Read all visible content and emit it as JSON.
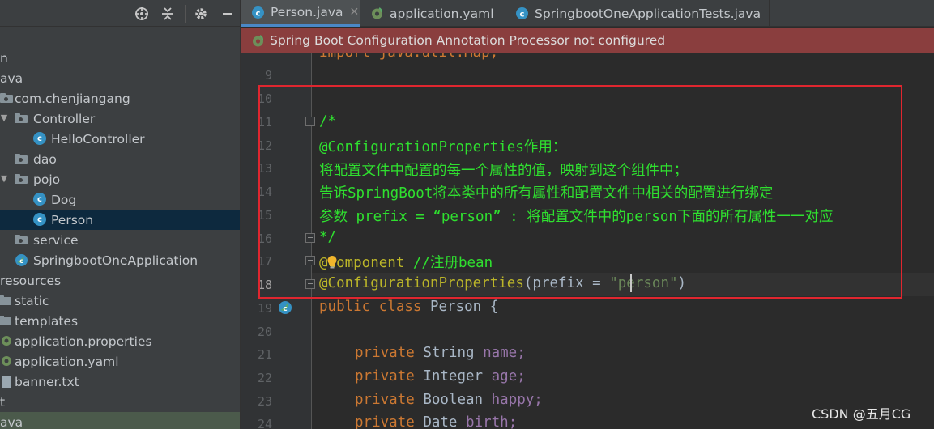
{
  "sidebar": {
    "toolbar_icons": [
      "target-icon",
      "collapse-icon",
      "gear-icon",
      "minimize-icon"
    ],
    "tree": [
      {
        "label": "n",
        "type": "text"
      },
      {
        "label": "ava",
        "type": "text"
      },
      {
        "label": "com.chenjiangang",
        "type": "package"
      },
      {
        "label": "Controller",
        "type": "package"
      },
      {
        "label": "HelloController",
        "type": "class"
      },
      {
        "label": "dao",
        "type": "package"
      },
      {
        "label": "pojo",
        "type": "package"
      },
      {
        "label": "Dog",
        "type": "class"
      },
      {
        "label": "Person",
        "type": "class",
        "selected": true
      },
      {
        "label": "service",
        "type": "package"
      },
      {
        "label": "SpringbootOneApplication",
        "type": "spring-class"
      },
      {
        "label": "resources",
        "type": "text"
      },
      {
        "label": "static",
        "type": "folder"
      },
      {
        "label": "templates",
        "type": "folder"
      },
      {
        "label": "application.properties",
        "type": "spring-file"
      },
      {
        "label": "application.yaml",
        "type": "spring-file"
      },
      {
        "label": "banner.txt",
        "type": "file"
      },
      {
        "label": "t",
        "type": "text"
      },
      {
        "label": "ava",
        "type": "text"
      }
    ]
  },
  "tabs": [
    {
      "label": "Person.java",
      "icon": "class-icon",
      "active": true,
      "closable": true
    },
    {
      "label": "application.yaml",
      "icon": "spring-config-icon",
      "active": false,
      "closable": false
    },
    {
      "label": "SpringbootOneApplicationTests.java",
      "icon": "class-icon",
      "active": false,
      "closable": false
    }
  ],
  "banner": {
    "text": "Spring Boot Configuration Annotation Processor not configured",
    "color": "#8a3e3e"
  },
  "editor": {
    "partial_top_line": "import java.util.Map;",
    "line_numbers": [
      "9",
      "10",
      "11",
      "12",
      "13",
      "14",
      "15",
      "16",
      "17",
      "18",
      "19",
      "20",
      "21",
      "22",
      "23",
      "24"
    ],
    "current_line": "18",
    "comment": {
      "open": "/*",
      "line1": "@ConfigurationProperties作用：",
      "line2": "将配置文件中配置的每一个属性的值，映射到这个组件中；",
      "line3": "告诉SpringBoot将本类中的所有属性和配置文件中相关的配置进行绑定",
      "line4": "参数 prefix = “person” : 将配置文件中的person下面的所有属性一一对应",
      "close": "*/"
    },
    "component_anno": "@Component",
    "component_comment": "//注册bean",
    "config_anno": "@ConfigurationProperties",
    "config_open": "(prefix = ",
    "config_str": "\"person\"",
    "config_close": ")",
    "class_kw": "public class",
    "class_name": "Person {",
    "fields": [
      {
        "kw": "private",
        "type": "String",
        "name": "name;"
      },
      {
        "kw": "private",
        "type": "Integer",
        "name": "age;"
      },
      {
        "kw": "private",
        "type": "Boolean",
        "name": "happy;"
      },
      {
        "kw": "private",
        "type": "Date",
        "name": "birth;"
      }
    ]
  },
  "colors": {
    "highlight_box": "#e0262f",
    "comment": "#2fe02f",
    "keyword": "#cc7832",
    "annotation": "#bbb529",
    "string": "#6a8759"
  },
  "watermark": "CSDN @五月CG"
}
